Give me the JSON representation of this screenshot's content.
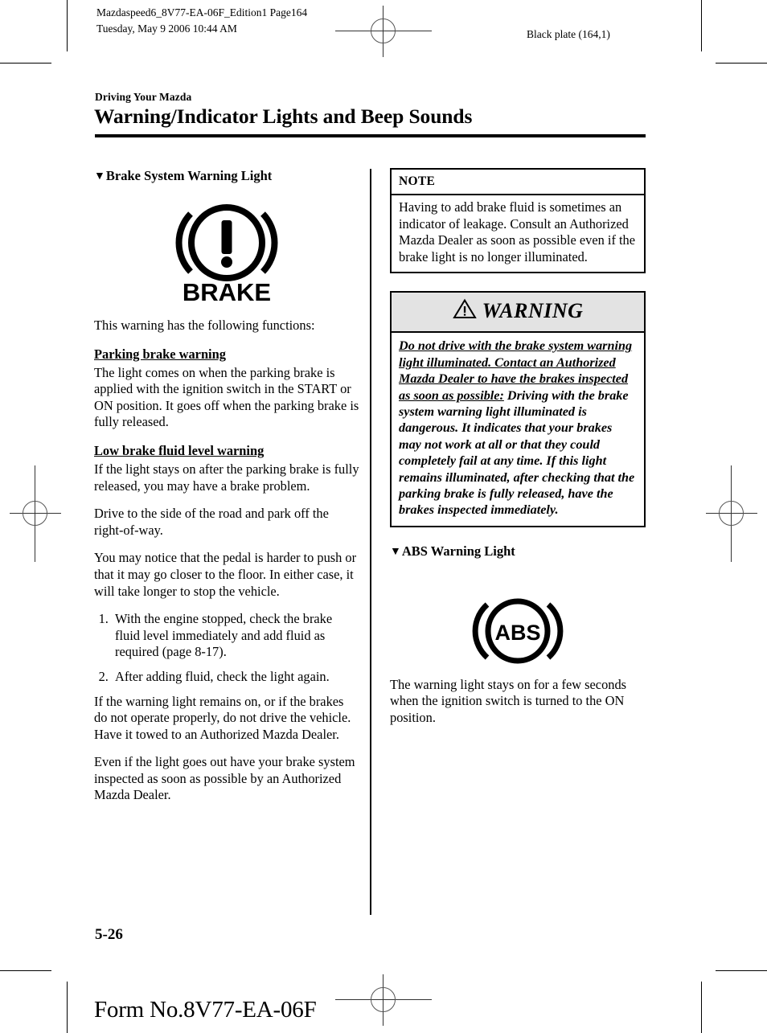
{
  "print_marks": {
    "slug_left": "Mazdaspeed6_8V77-EA-06F_Edition1 Page164\nTuesday, May 9 2006 10:44 AM",
    "slug_right": "Black plate (164,1)"
  },
  "header": {
    "chapter_label": "Driving Your Mazda",
    "title": "Warning/Indicator Lights and Beep Sounds"
  },
  "left_column": {
    "section_heading": "Brake System Warning Light",
    "triangle_glyph": "▼",
    "brake_icon_label": "BRAKE",
    "intro": "This warning has the following functions:",
    "sub1_heading": "Parking brake warning",
    "sub1_body": "The light comes on when the parking brake is applied with the ignition switch in the START or ON position. It goes off when the parking brake is fully released.",
    "sub2_heading": "Low brake fluid level warning",
    "sub2_body": "If the light stays on after the parking brake is fully released, you may have a brake problem.",
    "para3": "Drive to the side of the road and park off the right-of-way.",
    "para4": "You may notice that the pedal is harder to push or that it may go closer to the floor. In either case, it will take longer to stop the vehicle.",
    "steps": [
      "With the engine stopped, check the brake fluid level immediately and add fluid as required (page 8-17).",
      "After adding fluid, check the light again."
    ],
    "para5": "If the warning light remains on, or if the brakes do not operate properly, do not drive the vehicle. Have it towed to an Authorized Mazda Dealer.",
    "para6": "Even if the light goes out have your brake system inspected as soon as possible by an Authorized Mazda Dealer."
  },
  "right_column": {
    "note": {
      "heading": "NOTE",
      "body": "Having to add brake fluid is sometimes an indicator of leakage. Consult an Authorized Mazda Dealer as soon as possible even if the brake light is no longer illuminated."
    },
    "warning": {
      "heading": "WARNING",
      "body_underlined": "Do not drive with the brake system warning light illuminated. Contact an Authorized Mazda Dealer to have the brakes inspected as soon as possible:",
      "body_rest": " Driving with the brake system warning light illuminated is dangerous. It indicates that your brakes may not work at all or that they could completely fail at any time. If this light remains illuminated, after checking that the parking brake is fully released, have the brakes inspected immediately.",
      "header_bg": "#e3e3e3"
    },
    "abs_section": {
      "section_heading": "ABS Warning Light",
      "triangle_glyph": "▼",
      "abs_icon_label": "ABS",
      "body": "The warning light stays on for a few seconds when the ignition switch is turned to the ON position."
    }
  },
  "footer": {
    "folio": "5-26",
    "form_number": "Form No.8V77-EA-06F"
  }
}
